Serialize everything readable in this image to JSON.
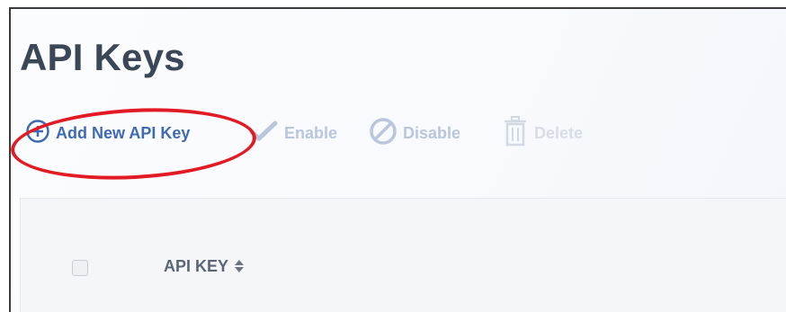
{
  "page": {
    "title": "API Keys"
  },
  "toolbar": {
    "add_label": "Add New API Key",
    "enable_label": "Enable",
    "disable_label": "Disable",
    "delete_label": "Delete"
  },
  "table": {
    "columns": [
      "API KEY"
    ]
  },
  "icons": {
    "add": "plus-circle-icon",
    "enable": "check-icon",
    "disable": "ban-icon",
    "delete": "trash-icon",
    "sort": "sort-icon"
  },
  "colors": {
    "accent": "#3f6ab3",
    "highlight": "#e21a23",
    "disabled": "#b9c6dc",
    "title": "#3b4656"
  }
}
